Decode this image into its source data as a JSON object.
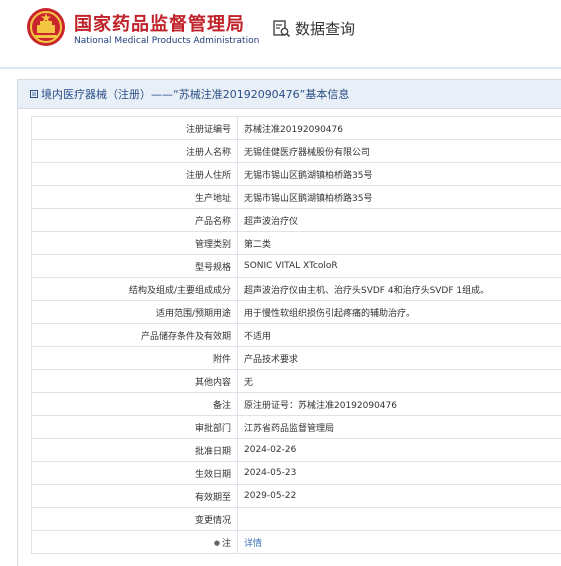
{
  "header": {
    "title_zh": "国家药品监督管理局",
    "title_en": "National Medical Products Administration",
    "query_label": "数据查询"
  },
  "panel": {
    "title": "境内医疗器械（注册）——“苏械注准20192090476”基本信息"
  },
  "rows": [
    {
      "label": "注册证编号",
      "value": "苏械注准20192090476"
    },
    {
      "label": "注册人名称",
      "value": "无锡佳健医疗器械股份有限公司"
    },
    {
      "label": "注册人住所",
      "value": "无锡市锡山区鹅湖镇柏桥路35号"
    },
    {
      "label": "生产地址",
      "value": "无锡市锡山区鹅湖镇柏桥路35号"
    },
    {
      "label": "产品名称",
      "value": "超声波治疗仪"
    },
    {
      "label": "管理类别",
      "value": "第二类"
    },
    {
      "label": "型号规格",
      "value": "SONIC VITAL XTcoloR"
    },
    {
      "label": "结构及组成/主要组成成分",
      "value": "超声波治疗仪由主机、治疗头SVDF 4和治疗头SVDF 1组成。"
    },
    {
      "label": "适用范围/预期用途",
      "value": "用于慢性软组织损伤引起疼痛的辅助治疗。"
    },
    {
      "label": "产品储存条件及有效期",
      "value": "不适用"
    },
    {
      "label": "附件",
      "value": "产品技术要求"
    },
    {
      "label": "其他内容",
      "value": "无"
    },
    {
      "label": "备注",
      "value": "原注册证号：苏械注准20192090476"
    },
    {
      "label": "审批部门",
      "value": "江苏省药品监督管理局"
    },
    {
      "label": "批准日期",
      "value": "2024-02-26"
    },
    {
      "label": "生效日期",
      "value": "2024-05-23"
    },
    {
      "label": "有效期至",
      "value": "2029-05-22"
    },
    {
      "label": "变更情况",
      "value": ""
    },
    {
      "label": "注",
      "value": "详情",
      "is_link": true
    }
  ],
  "colors": {
    "brand_red": "#c0222a",
    "brand_blue": "#1f3f7a",
    "link": "#3a6fb5",
    "panel_head_bg": "#e9eff7"
  }
}
